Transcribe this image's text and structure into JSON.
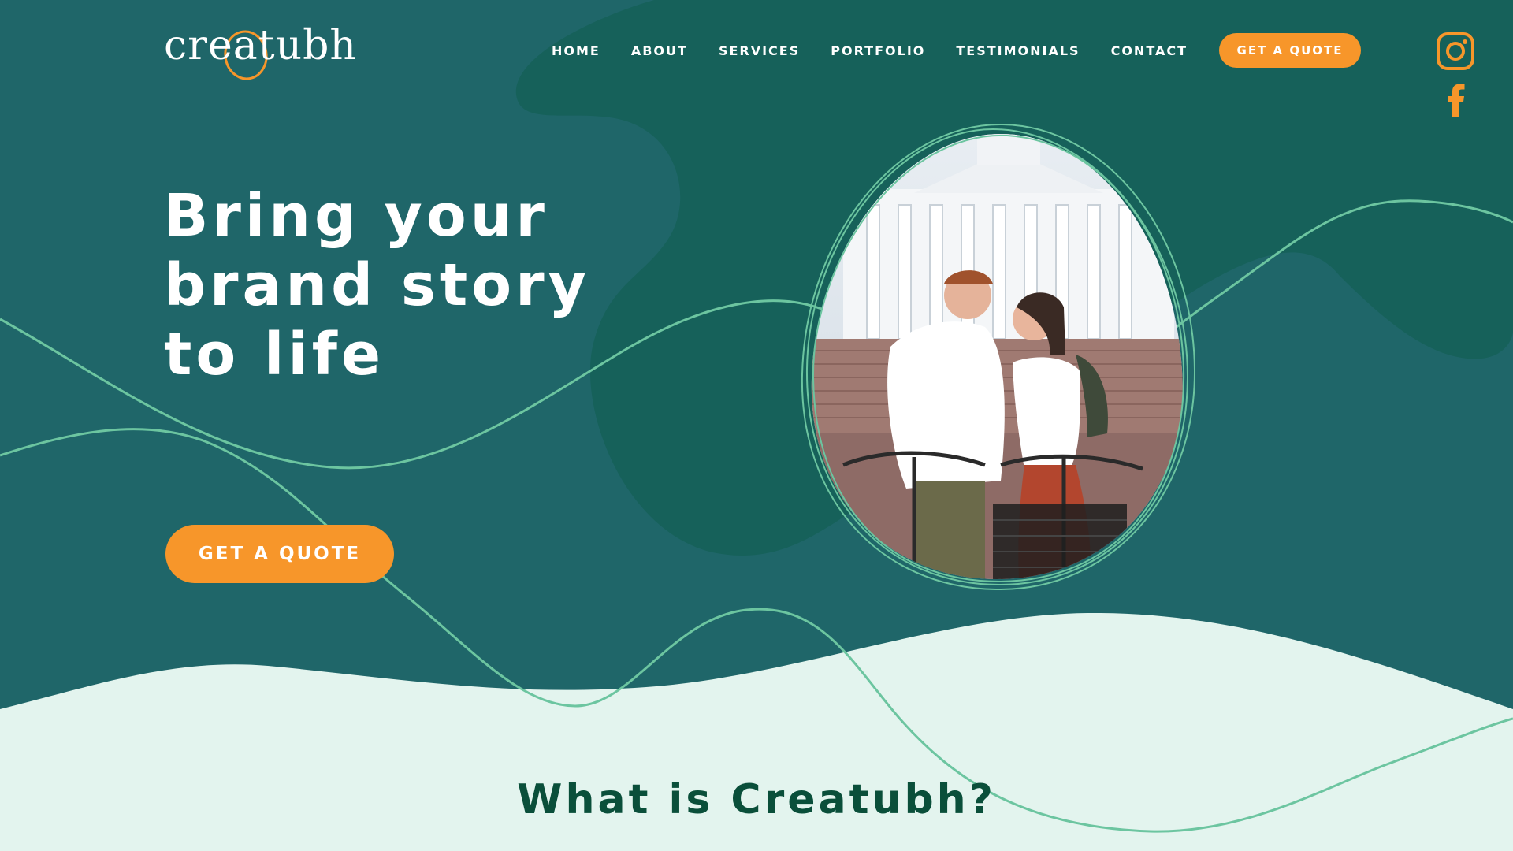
{
  "brand": {
    "logo_text": "creatubh"
  },
  "nav": {
    "items": [
      {
        "label": "HOME"
      },
      {
        "label": "ABOUT"
      },
      {
        "label": "SERVICES"
      },
      {
        "label": "PORTFOLIO"
      },
      {
        "label": "TESTIMONIALS"
      },
      {
        "label": "CONTACT"
      }
    ],
    "cta_label": "GET A QUOTE"
  },
  "social": {
    "icons": [
      "instagram-icon",
      "facebook-icon"
    ]
  },
  "hero": {
    "title_lines": [
      "Bring your",
      "brand story",
      "to life"
    ],
    "cta_label": "GET A QUOTE",
    "image": "photo of a couple with bicycles in front of a white cathedral"
  },
  "section": {
    "title": "What is Creatubh?"
  },
  "colors": {
    "background": "#1f6669",
    "blob": "#16615a",
    "accent": "#f7962a",
    "line": "#6cc5a0",
    "light_section": "#e3f4ee",
    "heading_dark": "#0a4f3a"
  }
}
